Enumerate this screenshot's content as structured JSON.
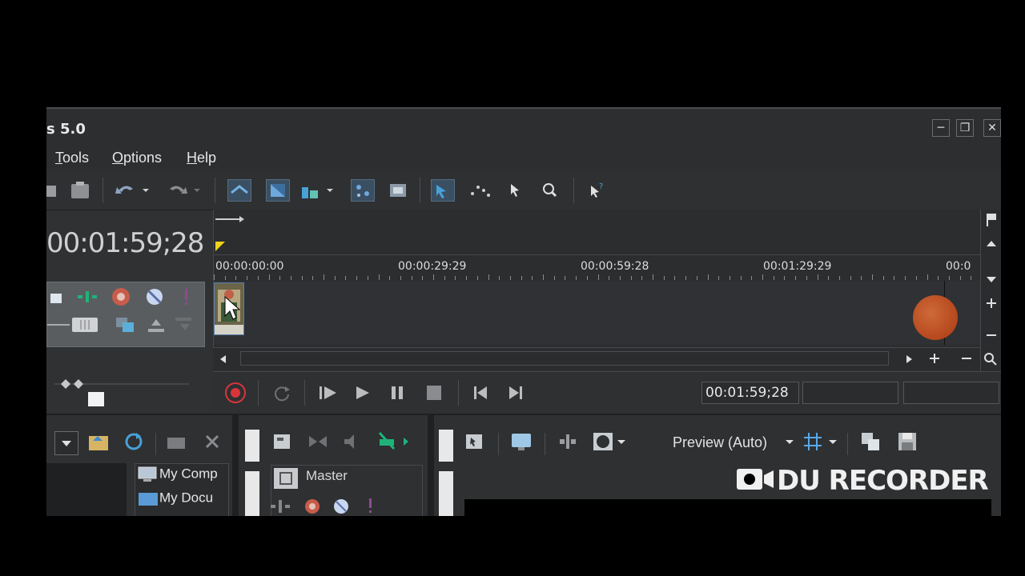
{
  "window": {
    "title_fragment": "s 5.0",
    "controls": {
      "minimize": "─",
      "restore": "❐",
      "close": "✕"
    }
  },
  "menu": [
    {
      "label": "Tools",
      "underline": "T",
      "rest": "ools"
    },
    {
      "label": "Options",
      "underline": "O",
      "rest": "ptions"
    },
    {
      "label": "Help",
      "underline": "H",
      "rest": "elp"
    }
  ],
  "timeline": {
    "current_time": "00:01:59;28",
    "ruler_labels": [
      "00:00:00:00",
      "00:00:29:29",
      "00:00:59:28",
      "00:01:29:29",
      "00:0"
    ]
  },
  "transport": {
    "timecode": "00:01:59;28",
    "field2": "",
    "field3": ""
  },
  "explorer": {
    "items": [
      "My Comp",
      "My Docu"
    ]
  },
  "mixer": {
    "master_label": "Master"
  },
  "preview": {
    "label": "Preview (Auto)"
  },
  "overlay": {
    "watermark": "DU RECORDER"
  },
  "colors": {
    "background": "#000000",
    "panel": "#2f3133",
    "record_red": "#d8353a",
    "accent_blue": "#3a4f61",
    "marker_yellow": "#f2d21a"
  }
}
